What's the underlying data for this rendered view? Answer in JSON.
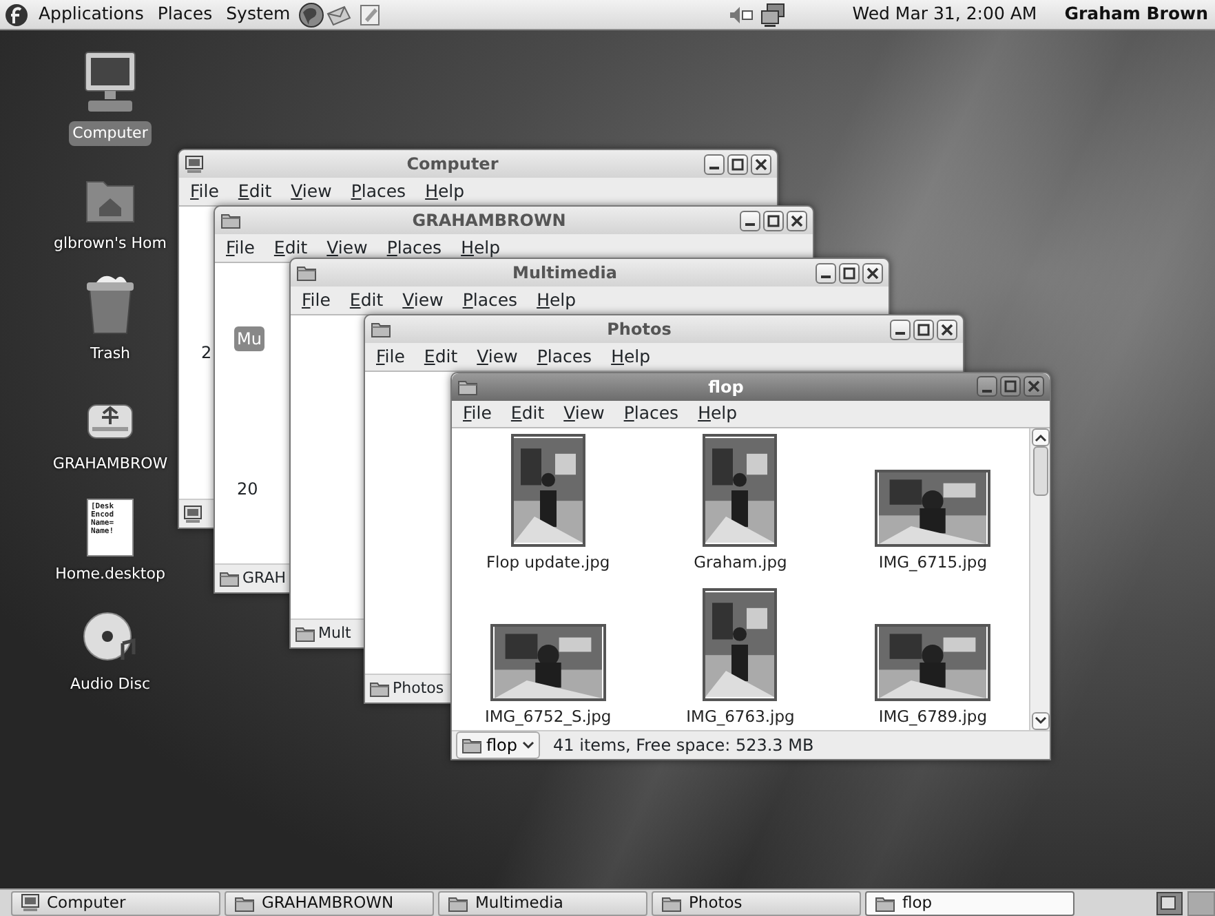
{
  "top_panel": {
    "menus": [
      "Applications",
      "Places",
      "System"
    ],
    "clock": "Wed Mar 31, 2:00 AM",
    "user": "Graham Brown"
  },
  "desktop_icons": [
    {
      "kind": "computer",
      "label": "Computer",
      "selected": true
    },
    {
      "kind": "home",
      "label": "glbrown's Hom",
      "selected": false
    },
    {
      "kind": "trash",
      "label": "Trash",
      "selected": false
    },
    {
      "kind": "drive",
      "label": "GRAHAMBROW",
      "selected": false
    },
    {
      "kind": "document",
      "label": "Home.desktop",
      "selected": false,
      "preview_lines": [
        "[Desk",
        "Encod",
        "Name=",
        "Name!"
      ]
    },
    {
      "kind": "disc",
      "label": "Audio Disc",
      "selected": false
    }
  ],
  "windows": [
    {
      "title": "Computer",
      "kind": "computer",
      "active": false,
      "menu": [
        "File",
        "Edit",
        "View",
        "Places",
        "Help"
      ],
      "fragments": [
        {
          "text": "2",
          "selected": false
        }
      ]
    },
    {
      "title": "GRAHAMBROWN",
      "kind": "folder",
      "active": false,
      "menu": [
        "File",
        "Edit",
        "View",
        "Places",
        "Help"
      ],
      "fragments": [
        {
          "text": "Mu",
          "selected": true
        },
        {
          "text": "20",
          "selected": false
        }
      ],
      "status_label": "GRAH"
    },
    {
      "title": "Multimedia",
      "kind": "folder",
      "active": false,
      "menu": [
        "File",
        "Edit",
        "View",
        "Places",
        "Help"
      ],
      "status_label": "Mult"
    },
    {
      "title": "Photos",
      "kind": "folder",
      "active": false,
      "menu": [
        "File",
        "Edit",
        "View",
        "Places",
        "Help"
      ],
      "status_label": "Photos"
    },
    {
      "title": "flop",
      "kind": "folder",
      "active": true,
      "menu": [
        "File",
        "Edit",
        "View",
        "Places",
        "Help"
      ],
      "files": [
        {
          "name": "Flop update.jpg",
          "kind": "portrait"
        },
        {
          "name": "Graham.jpg",
          "kind": "portrait"
        },
        {
          "name": "IMG_6715.jpg",
          "kind": "landscape"
        },
        {
          "name": "IMG_6752_S.jpg",
          "kind": "landscape"
        },
        {
          "name": "IMG_6763.jpg",
          "kind": "portrait"
        },
        {
          "name": "IMG_6789.jpg",
          "kind": "landscape"
        }
      ],
      "status_location": "flop",
      "status_text": "41 items, Free space: 523.3 MB"
    }
  ],
  "taskbar": [
    {
      "label": "Computer",
      "kind": "computer",
      "selected": false
    },
    {
      "label": "GRAHAMBROWN",
      "kind": "folder",
      "selected": false
    },
    {
      "label": "Multimedia",
      "kind": "folder",
      "selected": false
    },
    {
      "label": "Photos",
      "kind": "folder",
      "selected": false
    },
    {
      "label": "flop",
      "kind": "folder",
      "selected": true
    }
  ]
}
